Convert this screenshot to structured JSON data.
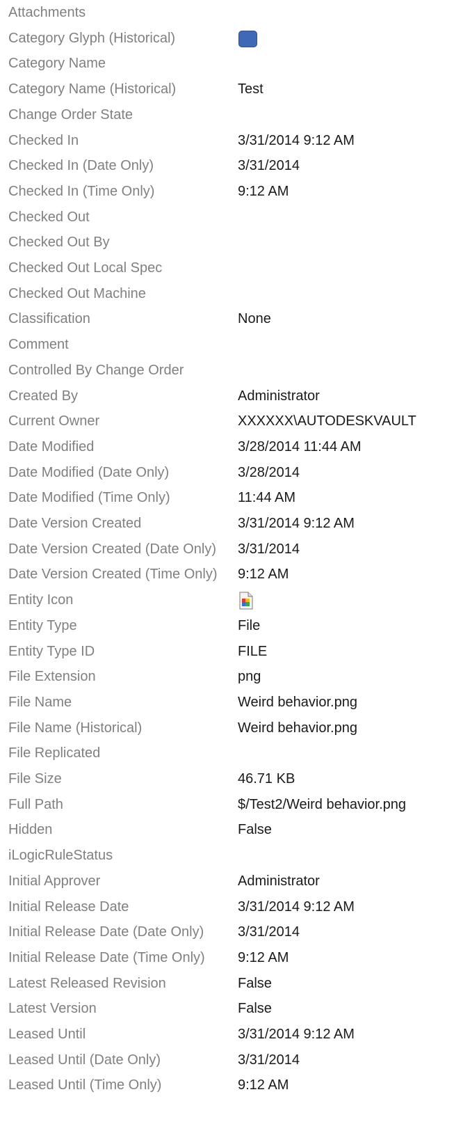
{
  "properties": [
    {
      "label": "Attachments",
      "value": ""
    },
    {
      "label": "Category Glyph (Historical)",
      "value": "",
      "icon": "blue-rounded-square-icon"
    },
    {
      "label": "Category Name",
      "value": ""
    },
    {
      "label": "Category Name (Historical)",
      "value": "Test"
    },
    {
      "label": "Change Order State",
      "value": ""
    },
    {
      "label": "Checked In",
      "value": "3/31/2014 9:12 AM"
    },
    {
      "label": "Checked In (Date Only)",
      "value": "3/31/2014"
    },
    {
      "label": "Checked In (Time Only)",
      "value": "9:12 AM"
    },
    {
      "label": "Checked Out",
      "value": ""
    },
    {
      "label": "Checked Out By",
      "value": ""
    },
    {
      "label": "Checked Out Local Spec",
      "value": ""
    },
    {
      "label": "Checked Out Machine",
      "value": ""
    },
    {
      "label": "Classification",
      "value": "None"
    },
    {
      "label": "Comment",
      "value": ""
    },
    {
      "label": "Controlled By Change Order",
      "value": ""
    },
    {
      "label": "Created By",
      "value": "Administrator"
    },
    {
      "label": "Current Owner",
      "value": "XXXXXX\\AUTODESKVAULT"
    },
    {
      "label": "Date Modified",
      "value": "3/28/2014 11:44 AM"
    },
    {
      "label": "Date Modified (Date Only)",
      "value": "3/28/2014"
    },
    {
      "label": "Date Modified (Time Only)",
      "value": "11:44 AM"
    },
    {
      "label": "Date Version Created",
      "value": "3/31/2014 9:12 AM"
    },
    {
      "label": "Date Version Created (Date Only)",
      "value": "3/31/2014"
    },
    {
      "label": "Date Version Created (Time Only)",
      "value": "9:12 AM"
    },
    {
      "label": "Entity Icon",
      "value": "",
      "icon": "image-file-icon"
    },
    {
      "label": "Entity Type",
      "value": "File"
    },
    {
      "label": "Entity Type ID",
      "value": "FILE"
    },
    {
      "label": "File Extension",
      "value": "png"
    },
    {
      "label": "File Name",
      "value": "Weird behavior.png"
    },
    {
      "label": "File Name (Historical)",
      "value": "Weird behavior.png"
    },
    {
      "label": "File Replicated",
      "value": ""
    },
    {
      "label": "File Size",
      "value": "46.71 KB"
    },
    {
      "label": "Full Path",
      "value": "$/Test2/Weird behavior.png"
    },
    {
      "label": "Hidden",
      "value": "False"
    },
    {
      "label": "iLogicRuleStatus",
      "value": ""
    },
    {
      "label": "Initial Approver",
      "value": "Administrator"
    },
    {
      "label": "Initial Release Date",
      "value": "3/31/2014 9:12 AM"
    },
    {
      "label": "Initial Release Date (Date Only)",
      "value": "3/31/2014"
    },
    {
      "label": "Initial Release Date (Time Only)",
      "value": "9:12 AM"
    },
    {
      "label": "Latest Released Revision",
      "value": "False"
    },
    {
      "label": "Latest Version",
      "value": "False"
    },
    {
      "label": "Leased Until",
      "value": "3/31/2014 9:12 AM"
    },
    {
      "label": "Leased Until (Date Only)",
      "value": "3/31/2014"
    },
    {
      "label": "Leased Until (Time Only)",
      "value": "9:12 AM"
    }
  ],
  "colors": {
    "label": "#808080",
    "value": "#1a1a1a",
    "glyph": "#3f68b5"
  }
}
